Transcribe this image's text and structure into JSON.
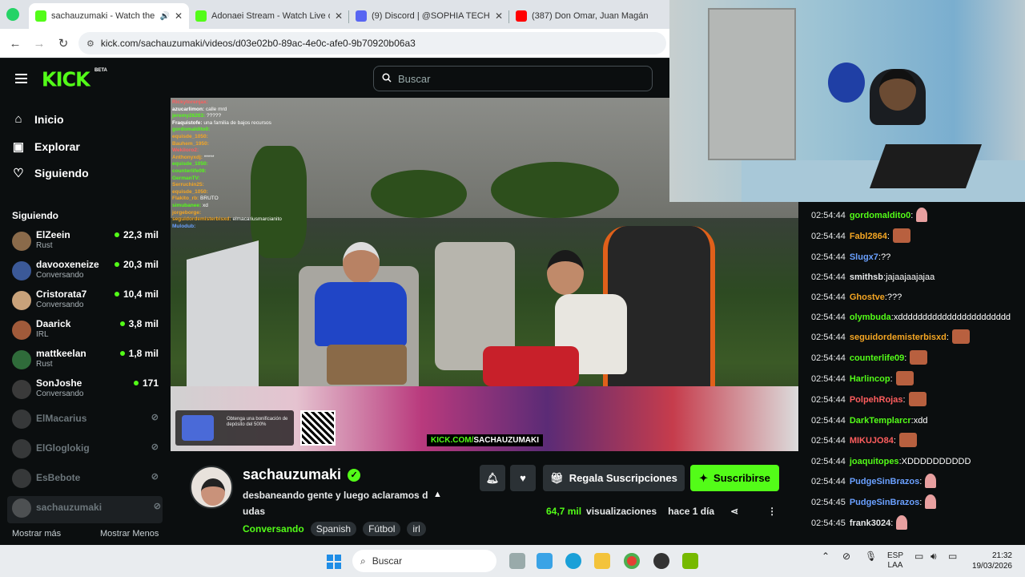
{
  "browser": {
    "tabs": [
      {
        "label": "sachauzumaki - Watch the V",
        "active": true,
        "favicon_color": "#53fc18",
        "audio": true
      },
      {
        "label": "Adonaei Stream - Watch Live o",
        "active": false,
        "favicon_color": "#53fc18"
      },
      {
        "label": "(9) Discord | @SOPHIA TECH P",
        "active": false,
        "favicon_color": "#5865f2"
      },
      {
        "label": "(387) Don Omar, Juan Magán",
        "active": false,
        "favicon_color": "#ff0000"
      }
    ],
    "url": "kick.com/sachauzumaki/videos/d03e02b0-89ac-4e0c-afe0-9b70920b06a3"
  },
  "header": {
    "logo": "KICK",
    "beta": "BETA",
    "search_placeholder": "Buscar"
  },
  "sidebar": {
    "nav": [
      {
        "label": "Inicio",
        "icon": "home-icon"
      },
      {
        "label": "Explorar",
        "icon": "compass-icon"
      },
      {
        "label": "Siguiendo",
        "icon": "heart-icon"
      }
    ],
    "following_title": "Siguiendo",
    "channels": [
      {
        "name": "ElZeein",
        "category": "Rust",
        "viewers": "22,3 mil",
        "live": true,
        "color": "#8a6a4a"
      },
      {
        "name": "davooxeneize",
        "category": "Conversando",
        "viewers": "20,3 mil",
        "live": true,
        "color": "#3b5998"
      },
      {
        "name": "Cristorata7",
        "category": "Conversando",
        "viewers": "10,4 mil",
        "live": true,
        "color": "#c9a27a"
      },
      {
        "name": "Daarick",
        "category": "IRL",
        "viewers": "3,8 mil",
        "live": true,
        "color": "#a05a3a"
      },
      {
        "name": "mattkeelan",
        "category": "Rust",
        "viewers": "1,8 mil",
        "live": true,
        "color": "#2f6b3a"
      },
      {
        "name": "SonJoshe",
        "category": "Conversando",
        "viewers": "171",
        "live": true,
        "color": "#3a3a3a"
      },
      {
        "name": "ElMacarius",
        "live": false,
        "color": "#777777"
      },
      {
        "name": "ElGloglokig",
        "live": false,
        "color": "#777777"
      },
      {
        "name": "EsBebote",
        "live": false,
        "color": "#777777"
      },
      {
        "name": "sachauzumaki",
        "live": false,
        "selected": true,
        "color": "#999999"
      }
    ],
    "show_more": "Mostrar más",
    "show_less": "Mostrar Menos"
  },
  "overlay_chat": [
    {
      "u": "Rickytorenjax:",
      "m": "",
      "c": "#ff5e5e"
    },
    {
      "u": "azucarlimon:",
      "m": "calle mrd",
      "c": "#ffffff"
    },
    {
      "u": "jeremy26203:",
      "m": "?????",
      "c": "#53fc18"
    },
    {
      "u": "Fraquistofe:",
      "m": "una familia de bajos recursos",
      "c": "#ffffff"
    },
    {
      "u": "gordomaldito0:",
      "m": "",
      "c": "#53fc18"
    },
    {
      "u": "equisde_1050:",
      "m": "",
      "c": "#f5a623"
    },
    {
      "u": "Bauhem_1950:",
      "m": "",
      "c": "#f5a623"
    },
    {
      "u": "Wekiloro2:",
      "m": "",
      "c": "#ff5e5e"
    },
    {
      "u": "Anthonyxdj:",
      "m": "*****",
      "c": "#f5a623"
    },
    {
      "u": "equisde_1050:",
      "m": "",
      "c": "#53fc18"
    },
    {
      "u": "counterlife09:",
      "m": "",
      "c": "#53fc18"
    },
    {
      "u": "GermanTV:",
      "m": "",
      "c": "#53fc18"
    },
    {
      "u": "Serruchin25:",
      "m": "",
      "c": "#f5a623"
    },
    {
      "u": "equisde_1050:",
      "m": "",
      "c": "#f5a623"
    },
    {
      "u": "Flakito_rb:",
      "m": "BRUTO",
      "c": "#f5a623"
    },
    {
      "u": "simubanee:",
      "m": "xd",
      "c": "#53fc18"
    },
    {
      "u": "jorgeborge:",
      "m": "",
      "c": "#f5a623"
    },
    {
      "u": "seguidordemisterbisxd:",
      "m": "elmacariusmarcianito",
      "c": "#f5a623"
    },
    {
      "u": "Mulodub:",
      "m": "",
      "c": "#6aa0ff"
    }
  ],
  "video_overlay": {
    "promo": "Obtenga una bonificación de depósito del 500%",
    "url_prefix": "KICK.COM/",
    "url_name": "SACHAUZUMAKI"
  },
  "chat": [
    {
      "t": "02:54:44",
      "u": "gordomaldito0",
      "m": "",
      "c": "#53fc18",
      "emote": "small"
    },
    {
      "t": "02:54:44",
      "u": "Fabl2864",
      "m": "",
      "c": "#f5a623",
      "emote": "face"
    },
    {
      "t": "02:54:44",
      "u": "Slugx7",
      "m": "??",
      "c": "#6aa0ff"
    },
    {
      "t": "02:54:44",
      "u": "smithsb",
      "m": "jajaajaajajaa",
      "c": "#e7e9ea"
    },
    {
      "t": "02:54:44",
      "u": "Ghostve",
      "m": "???",
      "c": "#f5a623"
    },
    {
      "t": "02:54:44",
      "u": "olymbuda",
      "m": "xddddddddddddddddddddddd",
      "c": "#53fc18"
    },
    {
      "t": "02:54:44",
      "u": "seguidordemisterbisxd",
      "m": "",
      "c": "#f5a623",
      "emote": "face"
    },
    {
      "t": "02:54:44",
      "u": "counterlife09",
      "m": "",
      "c": "#53fc18",
      "emote": "face"
    },
    {
      "t": "02:54:44",
      "u": "Harlincop",
      "m": "",
      "c": "#53fc18",
      "emote": "face"
    },
    {
      "t": "02:54:44",
      "u": "PolpehRojas",
      "m": "",
      "c": "#ff5e5e",
      "emote": "face"
    },
    {
      "t": "02:54:44",
      "u": "DarkTemplarcr",
      "m": "xdd",
      "c": "#53fc18"
    },
    {
      "t": "02:54:44",
      "u": "MIKUJO84",
      "m": "",
      "c": "#ff5e5e",
      "emote": "face"
    },
    {
      "t": "02:54:44",
      "u": "joaquitopes",
      "m": "XDDDDDDDDDD",
      "c": "#53fc18"
    },
    {
      "t": "02:54:44",
      "u": "PudgeSinBrazos",
      "m": "",
      "c": "#6aa0ff",
      "emote": "small"
    },
    {
      "t": "02:54:45",
      "u": "PudgeSinBrazos",
      "m": "",
      "c": "#6aa0ff",
      "emote": "small"
    },
    {
      "t": "02:54:45",
      "u": "frank3024",
      "m": "",
      "c": "#e7e9ea",
      "emote": "small"
    }
  ],
  "stream": {
    "name": "sachauzumaki",
    "title": "desbaneando gente y luego aclaramos d udas",
    "category": "Conversando",
    "tags": [
      "Spanish",
      "Fútbol",
      "irl"
    ],
    "gift_label": "Regala Suscripciones",
    "subscribe_label": "Suscribirse",
    "views_value": "64,7 mil",
    "views_label": "visualizaciones",
    "ago": "hace 1 día"
  },
  "taskbar": {
    "search": "Buscar",
    "lang1": "ESP",
    "lang2": "LAA",
    "time": "21:32",
    "date": "19/03/2026"
  }
}
